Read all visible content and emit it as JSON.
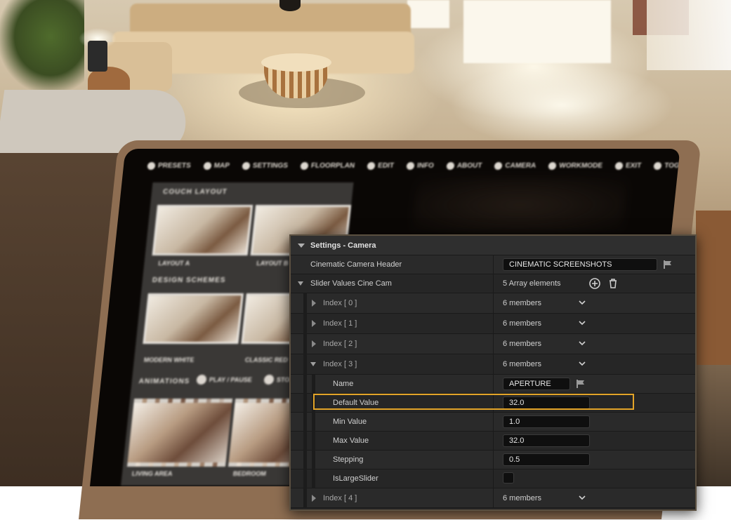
{
  "tablet": {
    "menu": [
      "PRESETS",
      "MAP",
      "SETTINGS",
      "FLOORPLAN",
      "EDIT",
      "INFO",
      "ABOUT",
      "CAMERA",
      "WORKMODE",
      "EXIT",
      "TOGGLE UI"
    ],
    "couch_heading": "COUCH LAYOUT",
    "layout_a": "LAYOUT A",
    "layout_b": "LAYOUT B",
    "design_heading": "DESIGN SCHEMES",
    "modern_white": "MODERN WHITE",
    "classic_red": "CLASSIC RED",
    "animations": "ANIMATIONS",
    "play_pause": "PLAY / PAUSE",
    "stop": "STOP",
    "living_area": "LIVING AREA",
    "bedroom": "BEDROOM"
  },
  "details": {
    "category": "Settings - Camera",
    "header_row": {
      "label": "Cinematic Camera Header",
      "value": "CINEMATIC SCREENSHOTS"
    },
    "array_row": {
      "label": "Slider Values Cine Cam",
      "value": "5 Array elements"
    },
    "indices": [
      {
        "label": "Index [ 0 ]",
        "value": "6 members"
      },
      {
        "label": "Index [ 1 ]",
        "value": "6 members"
      },
      {
        "label": "Index [ 2 ]",
        "value": "6 members"
      },
      {
        "label": "Index [ 3 ]",
        "value": "6 members"
      },
      {
        "label": "Index [ 4 ]",
        "value": "6 members"
      }
    ],
    "members": {
      "name": {
        "label": "Name",
        "value": "APERTURE"
      },
      "default": {
        "label": "Default Value",
        "value": "32.0"
      },
      "min": {
        "label": "Min Value",
        "value": "1.0"
      },
      "max": {
        "label": "Max Value",
        "value": "32.0"
      },
      "stepping": {
        "label": "Stepping",
        "value": "0.5"
      },
      "large": {
        "label": "IsLargeSlider",
        "checked": false
      }
    },
    "highlight_color": "#e3a428"
  }
}
